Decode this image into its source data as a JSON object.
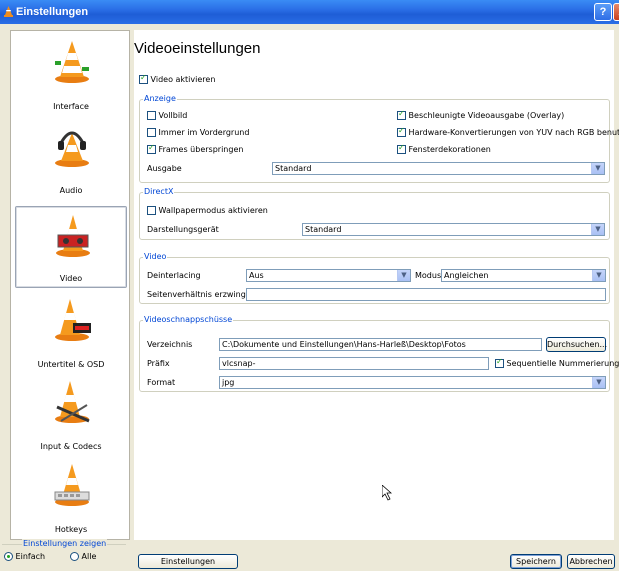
{
  "window": {
    "title": "Einstellungen",
    "help": "?",
    "close": "X"
  },
  "sidebar": {
    "items": [
      {
        "label": "Interface"
      },
      {
        "label": "Audio"
      },
      {
        "label": "Video"
      },
      {
        "label": "Untertitel & OSD"
      },
      {
        "label": "Input & Codecs"
      },
      {
        "label": "Hotkeys"
      }
    ],
    "show_label": "Einstellungen zeigen",
    "simple": "Einfach",
    "all": "Alle"
  },
  "main": {
    "title": "Videoeinstellungen",
    "video_enable": "Video aktivieren",
    "display": {
      "label": "Anzeige",
      "fullscreen": "Vollbild",
      "always_top": "Immer im Vordergrund",
      "skip_frames": "Frames überspringen",
      "overlay": "Beschleunigte Videoausgabe (Overlay)",
      "hw_yuv": "Hardware-Konvertierungen von YUV nach RGB benutzen",
      "decorations": "Fensterdekorationen",
      "output_label": "Ausgabe",
      "output_value": "Standard"
    },
    "directx": {
      "label": "DirectX",
      "wallpaper": "Wallpapermodus aktivieren",
      "device_label": "Darstellungsgerät",
      "device_value": "Standard"
    },
    "video": {
      "label": "Video",
      "deinterlace_label": "Deinterlacing",
      "deinterlace_value": "Aus",
      "mode_label": "Modus",
      "mode_value": "Angleichen",
      "aspect_label": "Seitenverhältnis erzwingen",
      "aspect_value": ""
    },
    "snapshots": {
      "label": "Videoschnappschüsse",
      "dir_label": "Verzeichnis",
      "dir_value": "C:\\Dokumente und Einstellungen\\Hans-Harleß\\Desktop\\Fotos",
      "browse": "Durchsuchen...",
      "prefix_label": "Präfix",
      "prefix_value": "vlcsnap-",
      "sequential": "Sequentielle Nummerierung",
      "format_label": "Format",
      "format_value": "jpg"
    }
  },
  "footer": {
    "reset": "Einstellungen zurücksetzen",
    "save": "Speichern",
    "cancel": "Abbrechen"
  }
}
